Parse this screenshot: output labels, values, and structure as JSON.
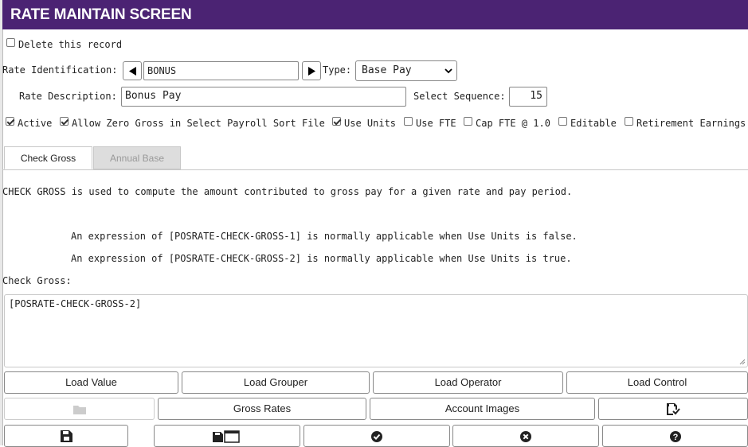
{
  "window": {
    "title": "RATE MAINTAIN SCREEN"
  },
  "delete_record": {
    "label": "Delete this record",
    "checked": false
  },
  "rate_identification": {
    "label": "Rate Identification:",
    "value": "BONUS"
  },
  "type": {
    "label": "Type:",
    "selected": "Base Pay"
  },
  "rate_description": {
    "label": "Rate Description:",
    "value": "Bonus Pay"
  },
  "select_sequence": {
    "label": "Select Sequence:",
    "value": "15"
  },
  "flags": [
    {
      "label": "Active",
      "checked": true
    },
    {
      "label": "Allow Zero Gross in Select Payroll Sort File",
      "checked": true
    },
    {
      "label": "Use Units",
      "checked": true
    },
    {
      "label": "Use FTE",
      "checked": false
    },
    {
      "label": "Cap FTE @ 1.0",
      "checked": false
    },
    {
      "label": "Editable",
      "checked": false
    },
    {
      "label": "Retirement Earnings",
      "checked": false
    }
  ],
  "tabs": [
    {
      "label": "Check Gross",
      "active": true
    },
    {
      "label": "Annual Base",
      "active": false
    }
  ],
  "help": {
    "line1": "CHECK GROSS is used to compute the amount contributed to gross pay for a given rate and pay period.",
    "line2": "An expression of [POSRATE-CHECK-GROSS-1] is normally applicable when Use Units is false.",
    "line3": "An expression of [POSRATE-CHECK-GROSS-2] is normally applicable when Use Units is true."
  },
  "check_gross": {
    "label": "Check Gross:",
    "value": "[POSRATE-CHECK-GROSS-2]"
  },
  "load_buttons": {
    "load_value": "Load Value",
    "load_grouper": "Load Grouper",
    "load_operator": "Load Operator",
    "load_control": "Load Control"
  },
  "action_buttons": {
    "gross_rates": "Gross Rates",
    "account_images": "Account Images"
  },
  "icons": [
    "folder-icon",
    "save-check-icon",
    "save-icon",
    "save-window-icon",
    "check-circle-icon",
    "x-circle-icon",
    "help-circle-icon"
  ]
}
